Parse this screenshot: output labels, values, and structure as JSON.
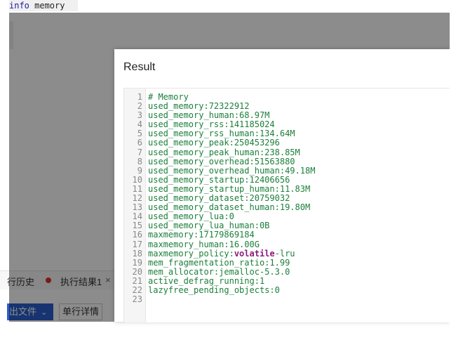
{
  "editor": {
    "query_keyword": "info",
    "query_rest": " memory"
  },
  "bottom_tabs": {
    "history_label": "行历史",
    "result_label": "执行结果1",
    "close_glyph": "×"
  },
  "bottom_actions": {
    "export_label": "出文件",
    "detail_label": "单行详情"
  },
  "dialog": {
    "title": "Result"
  },
  "result_lines": [
    {
      "num": "1",
      "text": "# Memory"
    },
    {
      "num": "2",
      "text": "used_memory:72322912"
    },
    {
      "num": "3",
      "text": "used_memory_human:68.97M"
    },
    {
      "num": "4",
      "text": "used_memory_rss:141185024"
    },
    {
      "num": "5",
      "text": "used_memory_rss_human:134.64M"
    },
    {
      "num": "6",
      "text": "used_memory_peak:250453296"
    },
    {
      "num": "7",
      "text": "used_memory_peak_human:238.85M"
    },
    {
      "num": "8",
      "text": "used_memory_overhead:51563880"
    },
    {
      "num": "9",
      "text": "used_memory_overhead_human:49.18M"
    },
    {
      "num": "10",
      "text": "used_memory_startup:12406656"
    },
    {
      "num": "11",
      "text": "used_memory_startup_human:11.83M"
    },
    {
      "num": "12",
      "text": "used_memory_dataset:20759032"
    },
    {
      "num": "13",
      "text": "used_memory_dataset_human:19.80M"
    },
    {
      "num": "14",
      "text": "used_memory_lua:0"
    },
    {
      "num": "15",
      "text": "used_memory_lua_human:0B"
    },
    {
      "num": "16",
      "text": "maxmemory:17179869184"
    },
    {
      "num": "17",
      "text": "maxmemory_human:16.00G"
    },
    {
      "num": "18",
      "text": "maxmemory_policy:",
      "kw": "volatile",
      "tail": "-lru"
    },
    {
      "num": "19",
      "text": "mem_fragmentation_ratio:1.99"
    },
    {
      "num": "20",
      "text": "mem_allocator:jemalloc-5.3.0"
    },
    {
      "num": "21",
      "text": "active_defrag_running:1"
    },
    {
      "num": "22",
      "text": "lazyfree_pending_objects:0"
    },
    {
      "num": "23",
      "text": ""
    }
  ]
}
